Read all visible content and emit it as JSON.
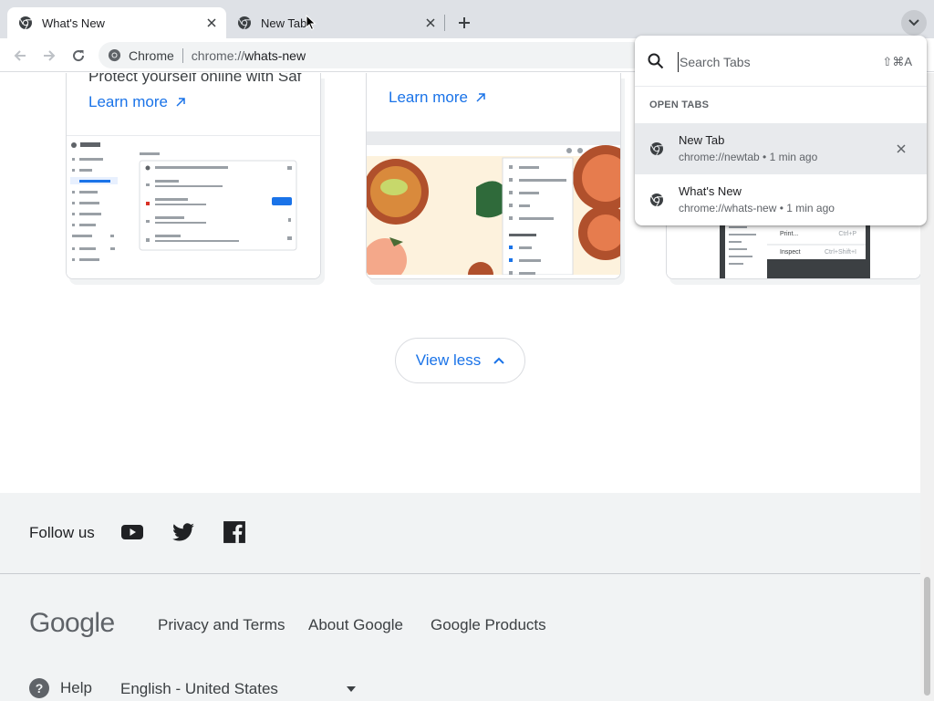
{
  "tabs": [
    {
      "title": "What's New",
      "active": true
    },
    {
      "title": "New Tab",
      "active": false
    }
  ],
  "toolbar": {
    "chip_label": "Chrome",
    "url_scheme": "chrome://",
    "url_host": "whats-new"
  },
  "page": {
    "cards": [
      {
        "cutoff_text": "Protect yourself online with Saf",
        "learn_more": "Learn more"
      },
      {
        "cutoff_text": "",
        "learn_more": "Learn more"
      }
    ],
    "view_less": "View less"
  },
  "footer": {
    "follow_us": "Follow us",
    "social": [
      "youtube-icon",
      "twitter-icon",
      "facebook-icon"
    ],
    "logo": "Google",
    "links": [
      "Privacy and Terms",
      "About Google",
      "Google Products"
    ],
    "help": "Help",
    "language": "English - United States"
  },
  "tab_search": {
    "placeholder": "Search Tabs",
    "shortcut": "⇧⌘A",
    "section_title": "OPEN TABS",
    "items": [
      {
        "title": "New Tab",
        "subtitle": "chrome://newtab • 1 min ago",
        "highlighted": true
      },
      {
        "title": "What's New",
        "subtitle": "chrome://whats-new • 1 min ago",
        "highlighted": false
      }
    ]
  },
  "colors": {
    "accent": "#1a73e8",
    "tabstrip": "#dee1e6",
    "footer_bg": "#f1f3f4"
  }
}
